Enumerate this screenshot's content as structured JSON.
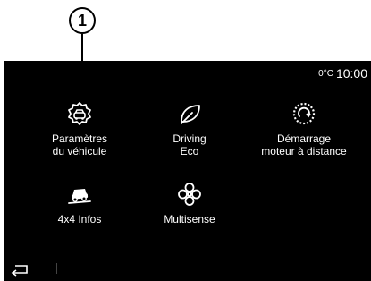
{
  "callout": {
    "number": "1"
  },
  "status": {
    "temperature": "0°C",
    "time": "10:00"
  },
  "apps": [
    {
      "label": "Paramètres\ndu véhicule",
      "icon": "vehicle-settings-icon"
    },
    {
      "label": "Driving\nEco",
      "icon": "eco-leaf-icon"
    },
    {
      "label": "Démarrage\nmoteur à distance",
      "icon": "remote-engine-start-icon"
    },
    {
      "label": "4x4 Infos",
      "icon": "offroad-4x4-icon"
    },
    {
      "label": "Multisense",
      "icon": "multisense-icon"
    }
  ],
  "nav": {
    "back_icon": "back-arrow-icon"
  }
}
